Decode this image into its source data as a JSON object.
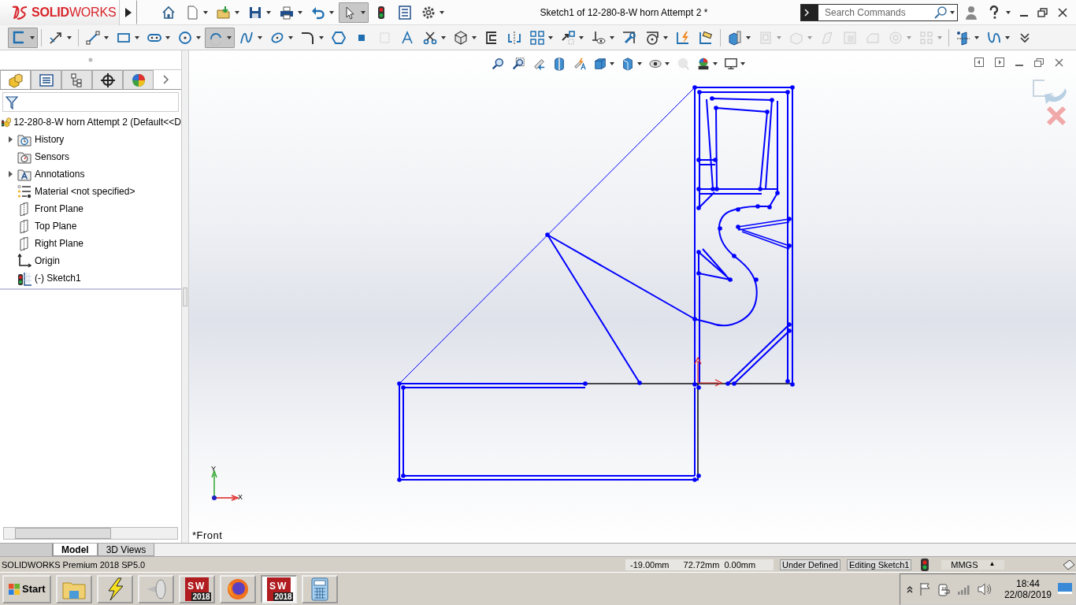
{
  "app_logo": "**SOLID**WORKS",
  "title": "Sketch1 of 12-280-8-W horn Attempt 2 *",
  "search": {
    "placeholder": "Search Commands"
  },
  "quick_access": [
    {
      "kind": "home",
      "selected": false,
      "dropdown": false
    },
    {
      "kind": "new",
      "selected": false,
      "dropdown": true
    },
    {
      "kind": "open",
      "selected": false,
      "dropdown": true
    },
    {
      "kind": "save",
      "selected": false,
      "dropdown": true
    },
    {
      "kind": "print",
      "selected": false,
      "dropdown": true
    },
    {
      "kind": "undo",
      "selected": false,
      "dropdown": true
    },
    {
      "kind": "select",
      "selected": true,
      "dropdown": true
    },
    {
      "kind": "rebuild",
      "selected": false,
      "dropdown": false
    },
    {
      "kind": "properties",
      "selected": false,
      "dropdown": false
    },
    {
      "kind": "options",
      "selected": false,
      "dropdown": true
    }
  ],
  "command_bar": [
    {
      "kind": "sketch",
      "selected": true,
      "dropdown": true,
      "disabled": false
    },
    {
      "kind": "dimension",
      "selected": false,
      "dropdown": true,
      "disabled": false
    },
    {
      "kind": "line",
      "selected": false,
      "dropdown": true,
      "disabled": false
    },
    {
      "kind": "rectangle",
      "selected": false,
      "dropdown": true,
      "disabled": false
    },
    {
      "kind": "slot",
      "selected": false,
      "dropdown": true,
      "disabled": false
    },
    {
      "kind": "circle",
      "selected": false,
      "dropdown": true,
      "disabled": false
    },
    {
      "kind": "arc",
      "selected": true,
      "dropdown": true,
      "disabled": false
    },
    {
      "kind": "spline",
      "selected": false,
      "dropdown": true,
      "disabled": false
    },
    {
      "kind": "ellipse",
      "selected": false,
      "dropdown": true,
      "disabled": false
    },
    {
      "kind": "fillet",
      "selected": false,
      "dropdown": true,
      "disabled": false
    },
    {
      "kind": "polygon",
      "selected": false,
      "dropdown": false,
      "disabled": false
    },
    {
      "kind": "point",
      "selected": false,
      "dropdown": false,
      "disabled": false
    },
    {
      "kind": "plane",
      "selected": false,
      "dropdown": false,
      "disabled": true
    },
    {
      "kind": "text",
      "selected": false,
      "dropdown": false,
      "disabled": false
    },
    {
      "kind": "trim",
      "selected": false,
      "dropdown": true,
      "disabled": false
    },
    {
      "kind": "convert",
      "selected": false,
      "dropdown": true,
      "disabled": false
    },
    {
      "kind": "offset",
      "selected": false,
      "dropdown": false,
      "disabled": false
    },
    {
      "kind": "mirror",
      "selected": false,
      "dropdown": false,
      "disabled": false
    },
    {
      "kind": "pattern",
      "selected": false,
      "dropdown": true,
      "disabled": false
    },
    {
      "kind": "move",
      "selected": false,
      "dropdown": true,
      "disabled": false
    },
    {
      "kind": "relations",
      "selected": false,
      "dropdown": true,
      "disabled": false
    },
    {
      "kind": "repair",
      "selected": false,
      "dropdown": false,
      "disabled": false
    },
    {
      "kind": "snaps",
      "selected": false,
      "dropdown": true,
      "disabled": false
    },
    {
      "kind": "rapid",
      "selected": false,
      "dropdown": false,
      "disabled": false
    },
    {
      "kind": "instant",
      "selected": false,
      "dropdown": false,
      "disabled": false
    },
    {
      "kind": "extrude",
      "selected": false,
      "dropdown": true,
      "disabled": false
    },
    {
      "kind": "cut",
      "selected": false,
      "dropdown": true,
      "disabled": true
    },
    {
      "kind": "revolve",
      "selected": false,
      "dropdown": true,
      "disabled": true
    },
    {
      "kind": "sweep",
      "selected": false,
      "dropdown": false,
      "disabled": true
    },
    {
      "kind": "shell",
      "selected": false,
      "dropdown": false,
      "disabled": true
    },
    {
      "kind": "chamfer",
      "selected": false,
      "dropdown": false,
      "disabled": true
    },
    {
      "kind": "hole",
      "selected": false,
      "dropdown": true,
      "disabled": true
    },
    {
      "kind": "feature-pattern",
      "selected": false,
      "dropdown": true,
      "disabled": true
    },
    {
      "kind": "reference",
      "selected": false,
      "dropdown": true,
      "disabled": false
    },
    {
      "kind": "curves",
      "selected": false,
      "dropdown": true,
      "disabled": false
    },
    {
      "kind": "more",
      "selected": false,
      "dropdown": false,
      "disabled": false
    }
  ],
  "panel_tabs": [
    {
      "kind": "feature-tree",
      "selected": true
    },
    {
      "kind": "property",
      "selected": false
    },
    {
      "kind": "configuration",
      "selected": false
    },
    {
      "kind": "dimxpert",
      "selected": false
    },
    {
      "kind": "display",
      "selected": false
    }
  ],
  "feature_tree": {
    "root": "12-280-8-W horn Attempt 2  (Default<<D",
    "items": [
      {
        "kind": "history",
        "label": "History",
        "collapsed": true
      },
      {
        "kind": "sensors",
        "label": "Sensors",
        "collapsed": false
      },
      {
        "kind": "annotations",
        "label": "Annotations",
        "collapsed": true
      },
      {
        "kind": "material",
        "label": "Material <not specified>",
        "collapsed": false
      },
      {
        "kind": "plane",
        "label": "Front Plane",
        "collapsed": false
      },
      {
        "kind": "plane",
        "label": "Top Plane",
        "collapsed": false
      },
      {
        "kind": "plane",
        "label": "Right Plane",
        "collapsed": false
      },
      {
        "kind": "origin",
        "label": "Origin",
        "collapsed": false
      },
      {
        "kind": "sketch",
        "label": "(-) Sketch1",
        "collapsed": false
      }
    ]
  },
  "heads_up": [
    {
      "kind": "zoom-fit",
      "dropdown": false,
      "disabled": false
    },
    {
      "kind": "zoom-area",
      "dropdown": false,
      "disabled": false
    },
    {
      "kind": "previous",
      "dropdown": false,
      "disabled": false
    },
    {
      "kind": "section",
      "dropdown": false,
      "disabled": false
    },
    {
      "kind": "annotation-view",
      "dropdown": false,
      "disabled": false
    },
    {
      "kind": "orientation",
      "dropdown": true,
      "disabled": false
    },
    {
      "kind": "display-style",
      "dropdown": true,
      "disabled": false
    },
    {
      "kind": "hide-show",
      "dropdown": true,
      "disabled": false
    },
    {
      "kind": "appearance",
      "dropdown": false,
      "disabled": true
    },
    {
      "kind": "scene",
      "dropdown": true,
      "disabled": false
    },
    {
      "kind": "view-settings",
      "dropdown": true,
      "disabled": false
    }
  ],
  "viewport": {
    "view_label": "*Front",
    "y_axis": "Y",
    "x_axis": "X"
  },
  "bottom_tabs": [
    {
      "label": "Model",
      "selected": true
    },
    {
      "label": "3D Views",
      "selected": false
    }
  ],
  "status_bar": {
    "product": "SOLIDWORKS Premium 2018 SP5.0",
    "x": "-19.00mm",
    "y": "72.72mm",
    "z": "0.00mm",
    "state": "Under Defined",
    "mode": "Editing Sketch1",
    "units": "MMGS",
    "units_arrow": "▲"
  },
  "taskbar": {
    "start": "Start",
    "items": [
      {
        "kind": "explorer",
        "selected": false
      },
      {
        "kind": "lightning",
        "selected": false
      },
      {
        "kind": "speaker",
        "selected": false
      },
      {
        "kind": "solidworks",
        "selected": false,
        "logo": "SW",
        "badge": "2018"
      },
      {
        "kind": "firefox",
        "selected": false
      },
      {
        "kind": "solidworks",
        "selected": true,
        "logo": "SW",
        "badge": "2018"
      },
      {
        "kind": "calculator",
        "selected": false
      }
    ],
    "time": "18:44",
    "date": "22/08/2019"
  }
}
